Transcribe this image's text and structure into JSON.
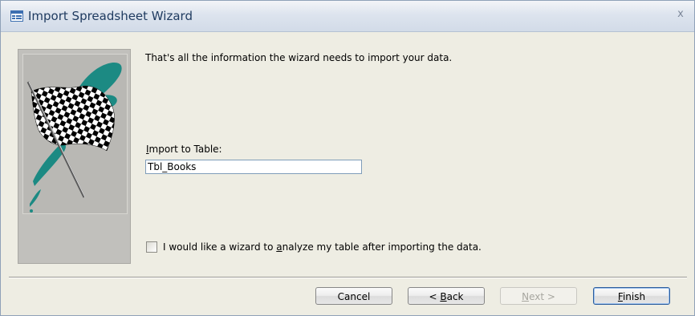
{
  "window": {
    "title": "Import Spreadsheet Wizard",
    "close_glyph": "x"
  },
  "main": {
    "intro_text": "That's all the information the wizard needs to import your data.",
    "import_label_prefix": "",
    "import_label_mnemonic": "I",
    "import_label_rest": "mport to Table:",
    "table_name": "Tbl_Books",
    "analyze_checkbox": {
      "checked": false,
      "label_before": "I would like a wizard to ",
      "label_mnemonic": "a",
      "label_after": "nalyze my table after importing the data."
    }
  },
  "buttons": {
    "cancel": "Cancel",
    "back_prefix": "< ",
    "back_mnemonic": "B",
    "back_rest": "ack",
    "next_mnemonic": "N",
    "next_rest": "ext >",
    "finish_mnemonic": "F",
    "finish_rest": "inish"
  },
  "icons": {
    "title": "wizard-window-icon",
    "side": "checkered-flag-icon"
  },
  "colors": {
    "accent_teal": "#1c8a83",
    "title_text": "#1e3a5f"
  }
}
